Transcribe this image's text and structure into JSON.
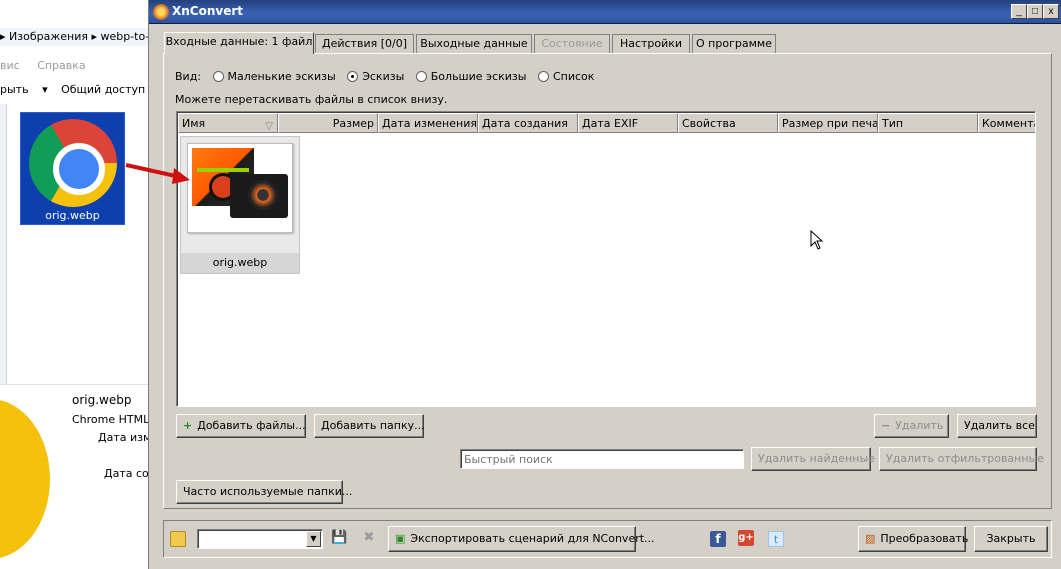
{
  "background_explorer": {
    "address_path": "▸ Изображения ▸ webp-to-jp",
    "menu": [
      "вис",
      "Справка"
    ],
    "toolbar": [
      "рыть",
      "▾",
      "Общий доступ"
    ],
    "desktop_icon_label": "orig.webp",
    "details": {
      "name": "orig.webp",
      "type": "Chrome HTML D",
      "date_modified": "Дата изме",
      "date_created": "Дата соз"
    }
  },
  "window": {
    "title": "XnConvert",
    "controls": {
      "minimize": "_",
      "maximize": "□",
      "close": "x"
    }
  },
  "tabs": [
    {
      "label": "Входные данные: 1 файл",
      "active": true,
      "disabled": false
    },
    {
      "label": "Действия [0/0]",
      "active": false,
      "disabled": false
    },
    {
      "label": "Выходные данные",
      "active": false,
      "disabled": false
    },
    {
      "label": "Состояние",
      "active": false,
      "disabled": true
    },
    {
      "label": "Настройки",
      "active": false,
      "disabled": false
    },
    {
      "label": "О программе",
      "active": false,
      "disabled": false
    }
  ],
  "view": {
    "label": "Вид:",
    "options": [
      {
        "label": "Маленькие эскизы",
        "checked": false
      },
      {
        "label": "Эскизы",
        "checked": true
      },
      {
        "label": "Большие эскизы",
        "checked": false
      },
      {
        "label": "Список",
        "checked": false
      }
    ]
  },
  "hint": "Можете перетаскивать файлы в список внизу.",
  "list": {
    "columns": [
      "Имя",
      "Размер",
      "Дата изменения",
      "Дата создания",
      "Дата EXIF",
      "Свойства",
      "Размер при печати",
      "Тип",
      "Комментар"
    ],
    "items": [
      {
        "name": "orig.webp"
      }
    ]
  },
  "buttons": {
    "add_files": "Добавить файлы...",
    "add_folder": "Добавить папку...",
    "remove": "Удалить",
    "remove_all": "Удалить все",
    "remove_found": "Удалить найденные",
    "remove_filtered": "Удалить отфильтрованные",
    "frequent_folders": "Часто используемые папки...",
    "export_script": "Экспортировать сценарий для NConvert...",
    "convert": "Преобразовать",
    "close": "Закрыть"
  },
  "search": {
    "placeholder": "Быстрый поиск",
    "value": ""
  },
  "social": {
    "facebook": "f",
    "google_plus": "g+",
    "twitter": "t"
  }
}
